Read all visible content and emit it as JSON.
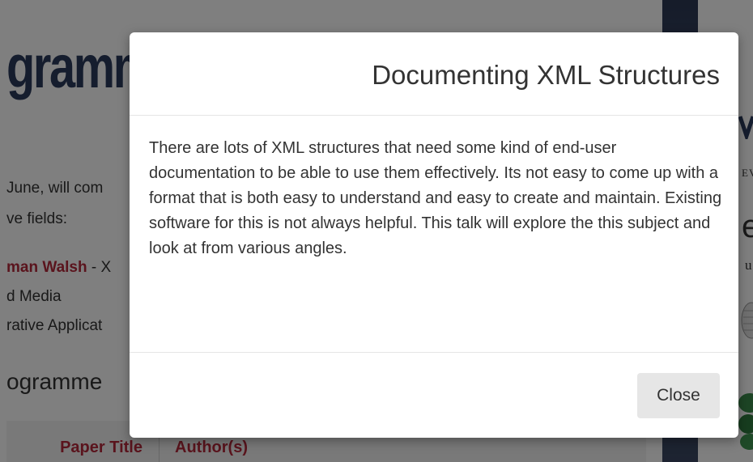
{
  "background": {
    "title_fragment": "gramm",
    "intro_lines": [
      "June, will com",
      "ve fields:"
    ],
    "speaker": {
      "name": "man Walsh",
      "suffix": " - X"
    },
    "fields": [
      "d Media",
      "rative Applicat"
    ],
    "section_heading": "ogramme",
    "table_headers": [
      "Paper Title",
      "Author(s)"
    ],
    "sidebar_fragments": [
      "EV",
      "e",
      "u",
      "u"
    ]
  },
  "modal": {
    "title": "Documenting XML Structures",
    "body": "There are lots of XML structures that need some kind of end-user documentation to be able to use them effectively. Its not easy to come up with a format that is both easy to understand and easy to create and maintain. Existing software for this is not always helpful. This talk will explore the this subject and look at from various angles.",
    "close_label": "Close"
  },
  "colors": {
    "accent_red": "#b5283a",
    "title_navy": "#2b3a5c",
    "backdrop": "rgba(0,0,0,0.5)",
    "button_gray": "#e6e6e6"
  }
}
